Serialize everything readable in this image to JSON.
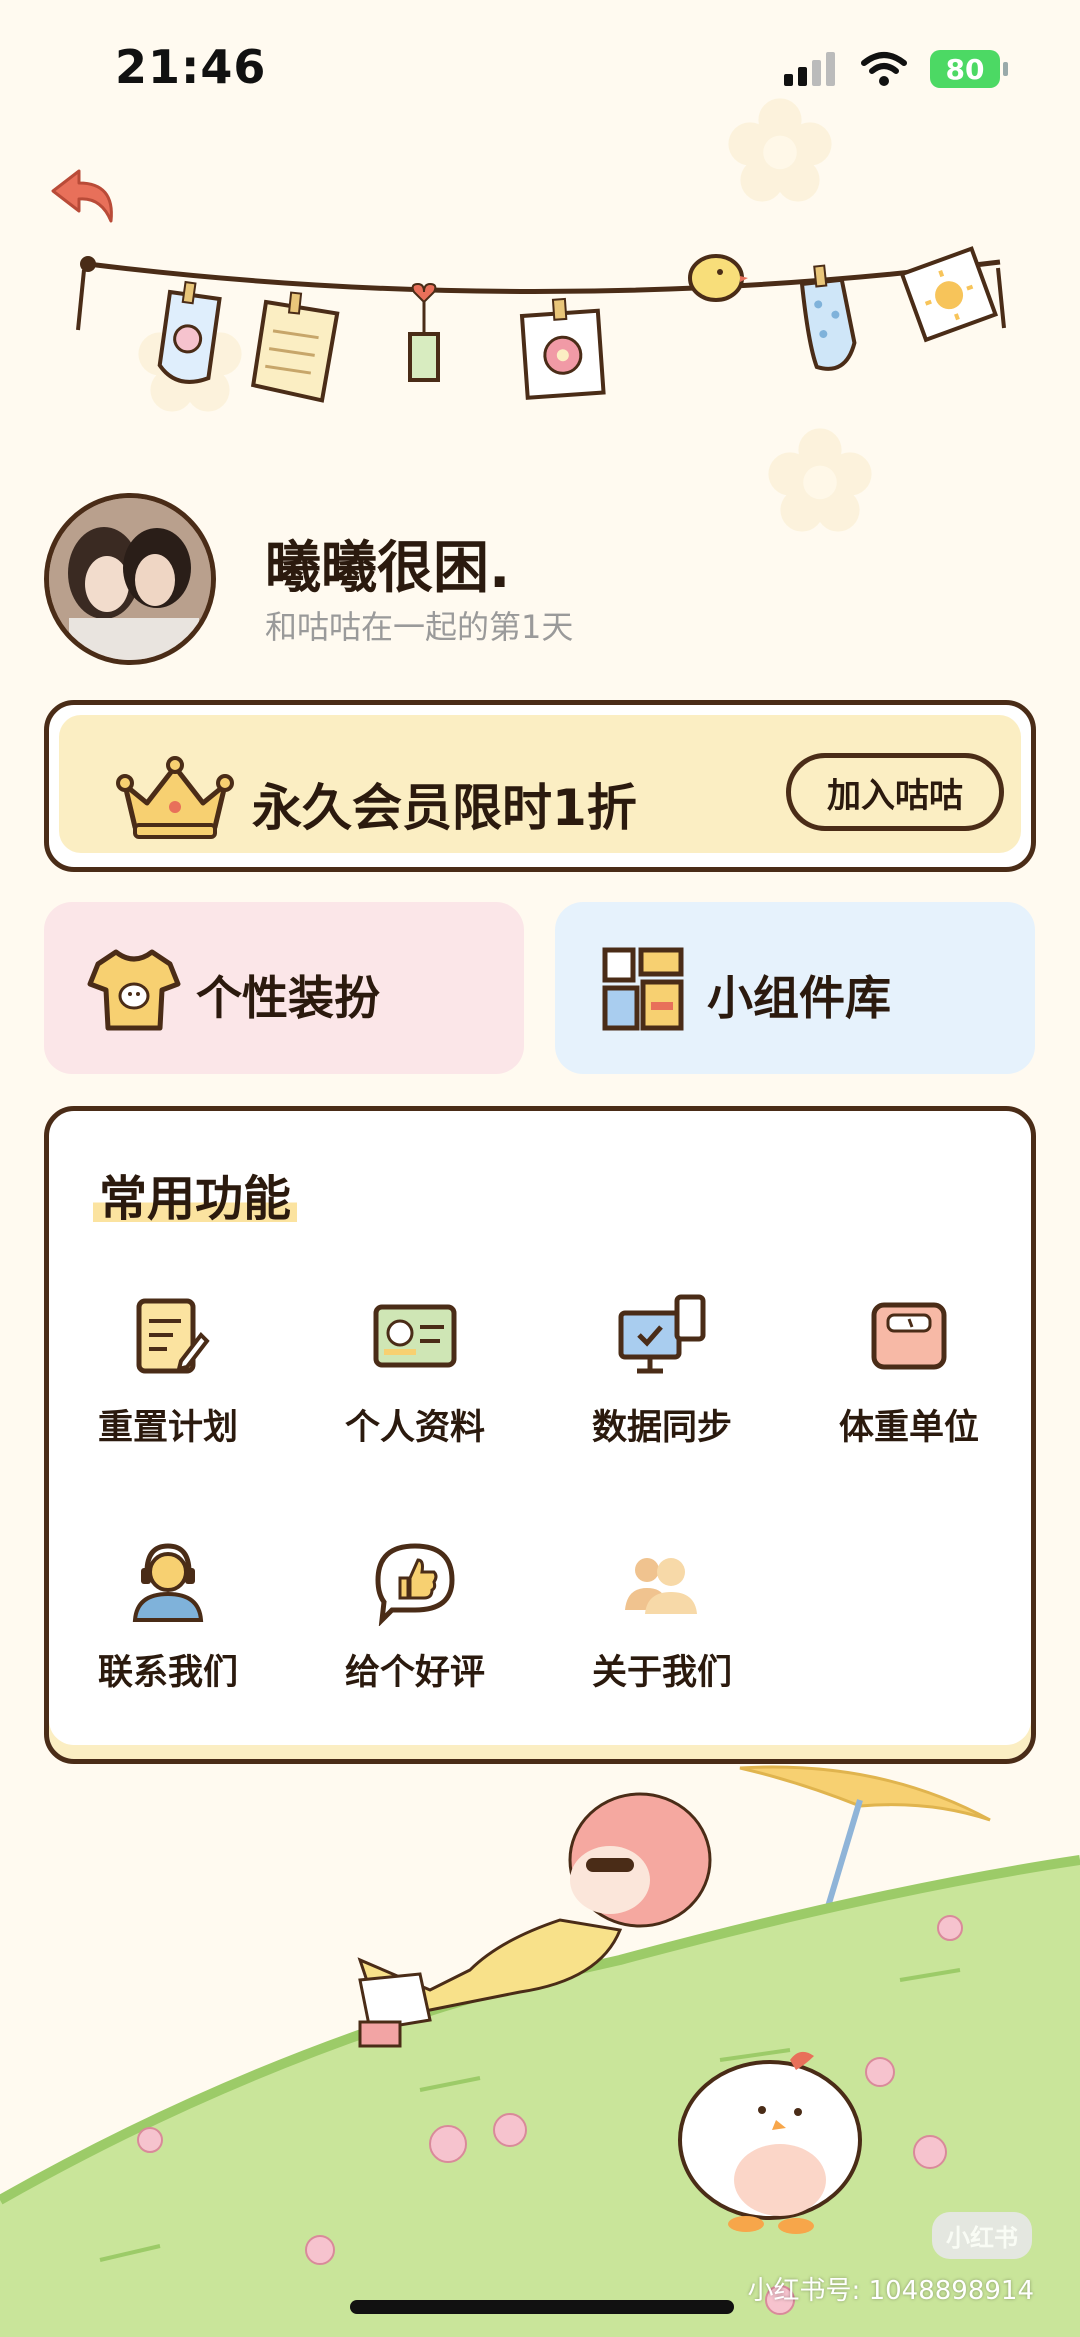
{
  "status_bar": {
    "time": "21:46",
    "battery": "80"
  },
  "profile": {
    "name": "曦曦很困.",
    "days_text": "和咕咕在一起的第1天"
  },
  "vip": {
    "text": "永久会员限时1折",
    "button": "加入咕咕"
  },
  "features": [
    {
      "label": "个性装扮"
    },
    {
      "label": "小组件库"
    }
  ],
  "common_functions": {
    "title": "常用功能",
    "items": [
      {
        "label": "重置计划",
        "icon": "notebook-icon"
      },
      {
        "label": "个人资料",
        "icon": "id-card-icon"
      },
      {
        "label": "数据同步",
        "icon": "sync-devices-icon"
      },
      {
        "label": "体重单位",
        "icon": "scale-icon"
      },
      {
        "label": "联系我们",
        "icon": "headset-icon"
      },
      {
        "label": "给个好评",
        "icon": "thumbs-up-icon"
      },
      {
        "label": "关于我们",
        "icon": "people-icon"
      }
    ]
  },
  "watermark": {
    "logo": "小红书",
    "text": "小红书号: 1048898914"
  },
  "colors": {
    "border": "#4a2c17",
    "vip_bg": "#fbeec3",
    "pink_card": "#fbe6e8",
    "blue_card": "#e6f2fc",
    "back_arrow": "#e8705a",
    "hill_green": "#c9e59a"
  }
}
